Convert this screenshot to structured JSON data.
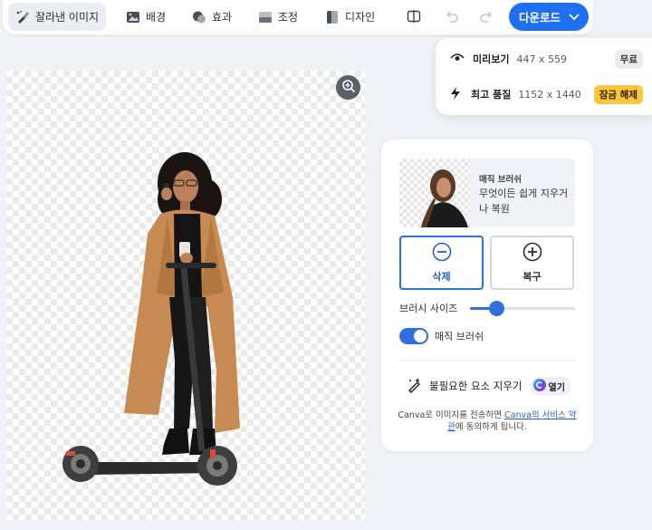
{
  "toolbar": {
    "tools": [
      {
        "label": "잘라낸 이미지",
        "icon": "brush-icon"
      },
      {
        "label": "배경",
        "icon": "image-icon"
      },
      {
        "label": "효과",
        "icon": "effects-icon"
      },
      {
        "label": "조정",
        "icon": "adjust-icon"
      },
      {
        "label": "디자인",
        "icon": "design-icon"
      }
    ],
    "download_label": "다운로드",
    "compare_icon": "compare-icon",
    "undo_icon": "undo-icon",
    "redo_icon": "redo-icon"
  },
  "download_menu": {
    "options": [
      {
        "label": "미리보기",
        "dims": "447 x 559",
        "badge": "무료",
        "icon": "eye-icon"
      },
      {
        "label": "최고 품질",
        "dims": "1152 x 1440",
        "badge": "잠금 해제",
        "icon": "bolt-icon"
      }
    ]
  },
  "panel": {
    "info_title": "매직 브러쉬",
    "info_desc": "무엇이든 쉽게 지우거나 복원",
    "erase_label": "삭제",
    "restore_label": "복구",
    "brush_size_label": "브러시 사이즈",
    "brush_size_fraction": 0.25,
    "magic_brush_label": "매직 브러쉬",
    "magic_brush_on": true,
    "erase_unwanted_label": "불필요한 요소 지우기",
    "open_label": "열기",
    "terms_prefix": "Canva로 이미지를 전송하면 ",
    "terms_link": "Canva의 서비스 약관",
    "terms_suffix": "에 동의하게 됩니다."
  },
  "colors": {
    "accent": "#1f6ff2",
    "unlock_badge": "#fbc63c"
  }
}
